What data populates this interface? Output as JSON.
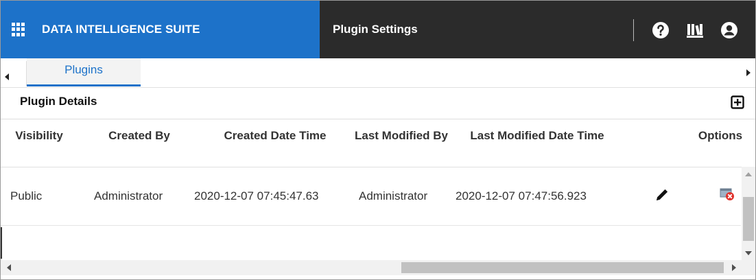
{
  "header": {
    "app_title": "DATA INTELLIGENCE SUITE",
    "page_title": "Plugin Settings",
    "brand_color": "#1d72c9",
    "bar_color": "#2b2b2b",
    "icons": [
      "apps-grid-icon",
      "help-icon",
      "library-icon",
      "user-account-icon"
    ]
  },
  "tabs": [
    {
      "label": "Plugins",
      "active": true
    }
  ],
  "section": {
    "title": "Plugin Details",
    "add_icon": "add-square-icon"
  },
  "table": {
    "columns": [
      {
        "label": "Visibility"
      },
      {
        "label": "Created By"
      },
      {
        "label": "Created Date Time"
      },
      {
        "label": "Last Modified By"
      },
      {
        "label": "Last Modified Date Time"
      },
      {
        "label": "Options"
      }
    ],
    "rows": [
      {
        "visibility": "Public",
        "created_by": "Administrator",
        "created_date_time": "2020-12-07 07:45:47.63",
        "last_modified_by": "Administrator",
        "last_modified_date_time": "2020-12-07 07:47:56.923",
        "actions": [
          "edit-pencil-icon",
          "delete-icon"
        ]
      }
    ]
  }
}
